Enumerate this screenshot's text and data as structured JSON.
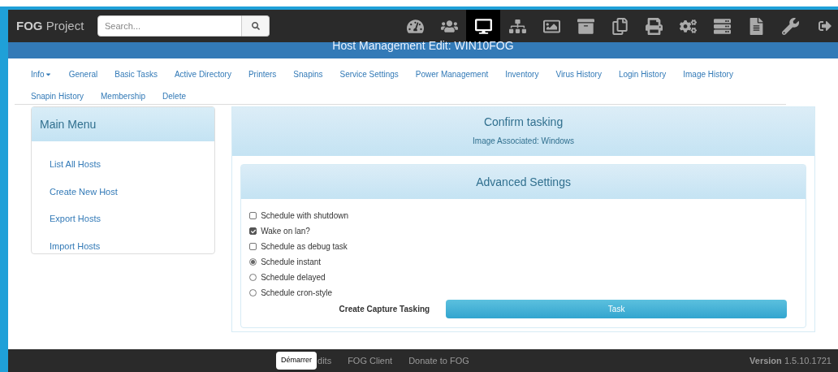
{
  "brand": {
    "bold": "FOG",
    "rest": "Project"
  },
  "search": {
    "placeholder": "Search..."
  },
  "nav_icons": [
    {
      "selected": false
    },
    {
      "selected": false
    },
    {
      "selected": true
    },
    {
      "selected": false
    },
    {
      "selected": false
    },
    {
      "selected": false
    },
    {
      "selected": false
    },
    {
      "selected": false
    },
    {
      "selected": false
    },
    {
      "selected": false
    },
    {
      "selected": false
    },
    {
      "selected": false
    }
  ],
  "page_title": "Host Management Edit: WIN10FOG",
  "tabs": [
    {
      "label": "Info",
      "dropdown": true
    },
    {
      "label": "General",
      "dropdown": false
    },
    {
      "label": "Basic Tasks",
      "dropdown": false
    },
    {
      "label": "Active Directory",
      "dropdown": false
    },
    {
      "label": "Printers",
      "dropdown": false
    },
    {
      "label": "Snapins",
      "dropdown": false
    },
    {
      "label": "Service Settings",
      "dropdown": false
    },
    {
      "label": "Power Management",
      "dropdown": false
    },
    {
      "label": "Inventory",
      "dropdown": false
    },
    {
      "label": "Virus History",
      "dropdown": false
    },
    {
      "label": "Login History",
      "dropdown": false
    },
    {
      "label": "Image History",
      "dropdown": false
    },
    {
      "label": "Snapin History",
      "dropdown": false
    },
    {
      "label": "Membership",
      "dropdown": false
    },
    {
      "label": "Delete",
      "dropdown": false
    }
  ],
  "sidebar": {
    "title": "Main Menu",
    "items": [
      "List All Hosts",
      "Create New Host",
      "Export Hosts",
      "Import Hosts"
    ]
  },
  "confirm": {
    "title": "Confirm tasking",
    "subtitle": "Image Associated: Windows"
  },
  "advanced": {
    "title": "Advanced Settings",
    "options": [
      {
        "kind": "checkbox",
        "label": "Schedule with shutdown",
        "checked": false
      },
      {
        "kind": "checkbox",
        "label": "Wake on lan?",
        "checked": true
      },
      {
        "kind": "checkbox",
        "label": "Schedule as debug task",
        "checked": false
      },
      {
        "kind": "radio",
        "label": "Schedule instant",
        "checked": true
      },
      {
        "kind": "radio",
        "label": "Schedule delayed",
        "checked": false
      },
      {
        "kind": "radio",
        "label": "Schedule cron-style",
        "checked": false
      }
    ],
    "action_label": "Create Capture Tasking",
    "button": "Task"
  },
  "tooltip": "Démarrer",
  "footer": {
    "links": [
      "dits",
      "FOG Client",
      "Donate to FOG"
    ],
    "version_label": "Version",
    "version": "1.5.10.1721"
  }
}
